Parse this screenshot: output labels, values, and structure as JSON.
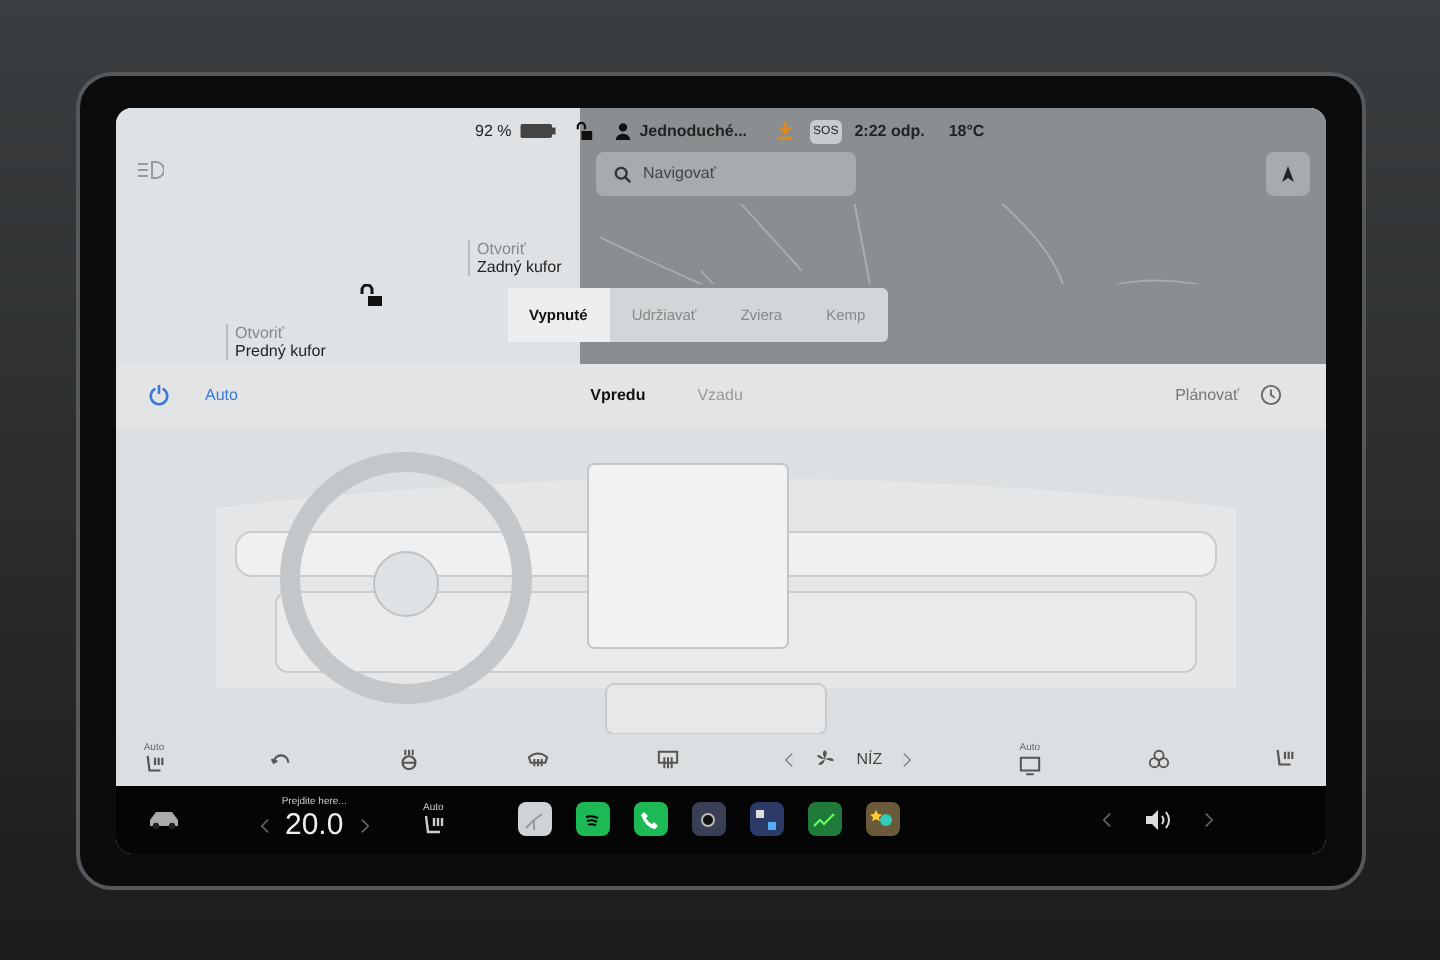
{
  "status_bar": {
    "battery": "92 %",
    "profile": "Jednoduché...",
    "sos": "SOS",
    "time": "2:22 odp.",
    "temperature": "18°C"
  },
  "car_panel": {
    "frunk": {
      "action": "Otvoriť",
      "label": "Predný kufor"
    },
    "trunk": {
      "action": "Otvoriť",
      "label": "Zadný kufor"
    },
    "locked": false
  },
  "map": {
    "search": {
      "placeholder": "Navigovať"
    }
  },
  "climate_modes": [
    {
      "label": "Vypnuté",
      "selected": true
    },
    {
      "label": "Udržiavať",
      "selected": false
    },
    {
      "label": "Zviera",
      "selected": false
    },
    {
      "label": "Kemp",
      "selected": false
    }
  ],
  "climate_header": {
    "auto": {
      "label": "Auto",
      "on": true
    },
    "zones": [
      {
        "label": "Vpredu",
        "selected": true
      },
      {
        "label": "Vzadu",
        "selected": false
      }
    ],
    "schedule": "Plánovať"
  },
  "climate_controls": [
    {
      "kind": "seat",
      "caption": "Auto"
    },
    {
      "kind": "recirculate"
    },
    {
      "kind": "wheel"
    },
    {
      "kind": "front-defrost"
    },
    {
      "kind": "rear-defrost"
    },
    {
      "kind": "fan",
      "value": "NÍZ"
    },
    {
      "kind": "defog",
      "caption": "Auto"
    },
    {
      "kind": "biohazard"
    },
    {
      "kind": "seat"
    }
  ],
  "taskbar": {
    "temperature": {
      "caption": "Prejdite here...",
      "value": "20.0"
    },
    "seat": {
      "caption": "Auto"
    },
    "apps": [
      {
        "kind": "map",
        "color": "#cfd3d6"
      },
      {
        "kind": "spotify",
        "color": "#1db954"
      },
      {
        "kind": "phone",
        "color": "#1db954"
      },
      {
        "kind": "camera",
        "color": "#3a3f55"
      },
      {
        "kind": "toybox",
        "color": "#2b3a66"
      },
      {
        "kind": "chart",
        "color": "#1f7a3a"
      },
      {
        "kind": "games",
        "color": "#6b5a3a"
      }
    ]
  }
}
